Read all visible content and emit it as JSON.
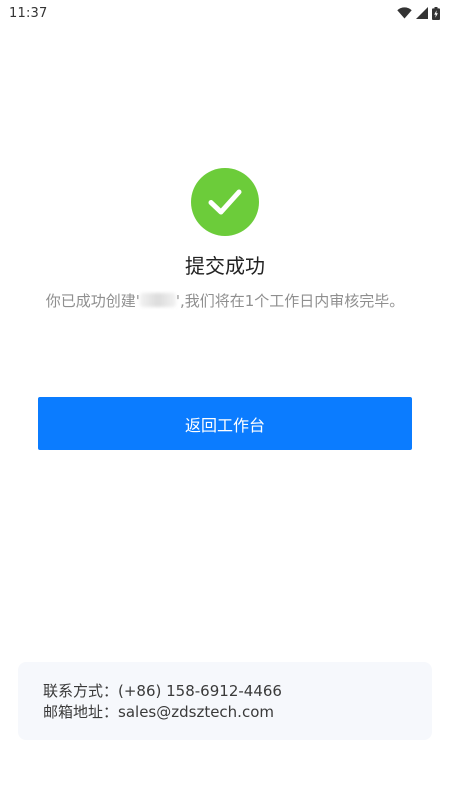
{
  "status_bar": {
    "time": "11:37",
    "icons": [
      "wifi-icon",
      "signal-icon",
      "battery-icon"
    ]
  },
  "result": {
    "icon": "check-circle-icon",
    "icon_color": "#6ccc3a",
    "title": "提交成功",
    "description_before": "你已成功创建'",
    "description_after": "',我们将在1个工作日内审核完毕。"
  },
  "action": {
    "button_label": "返回工作台",
    "button_color": "#0b7cff"
  },
  "contact": {
    "phone_label": "联系方式：",
    "phone_value": "(+86) 158-6912-4466",
    "email_label": "邮箱地址：",
    "email_value": "sales@zdsztech.com"
  }
}
